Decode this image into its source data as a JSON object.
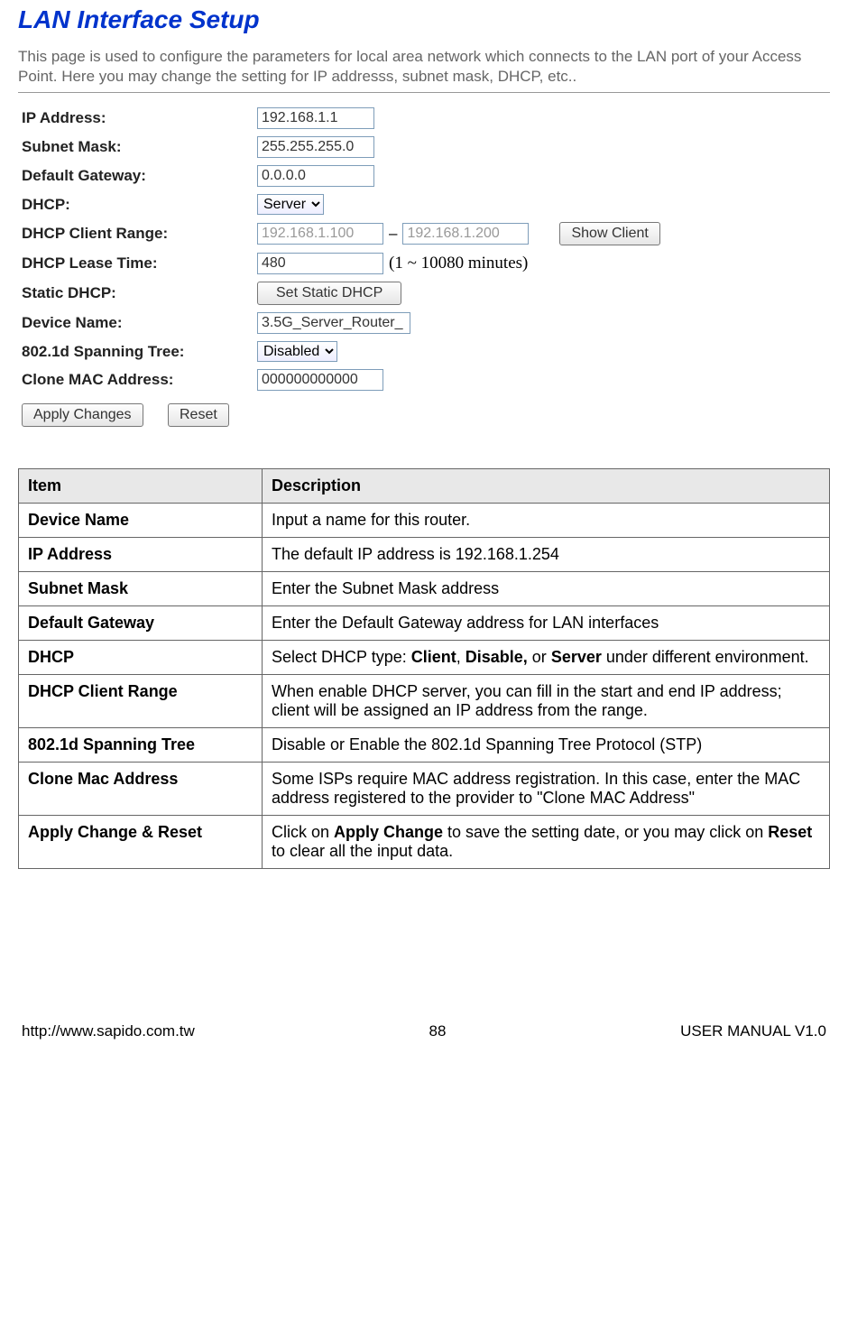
{
  "title": "LAN Interface Setup",
  "intro": "This page is used to configure the parameters for local area network which connects to the LAN port of your Access Point. Here you may change the setting for IP addresss, subnet mask, DHCP, etc..",
  "form": {
    "ip_address": {
      "label": "IP Address:",
      "value": "192.168.1.1"
    },
    "subnet_mask": {
      "label": "Subnet Mask:",
      "value": "255.255.255.0"
    },
    "default_gateway": {
      "label": "Default Gateway:",
      "value": "0.0.0.0"
    },
    "dhcp": {
      "label": "DHCP:",
      "value": "Server"
    },
    "dhcp_range": {
      "label": "DHCP Client Range:",
      "start": "192.168.1.100",
      "end": "192.168.1.200",
      "dash": "–",
      "show_client_btn": "Show Client"
    },
    "lease_time": {
      "label": "DHCP Lease Time:",
      "value": "480",
      "note": "(1 ~ 10080 minutes)"
    },
    "static_dhcp": {
      "label": "Static DHCP:",
      "btn": "Set Static DHCP"
    },
    "device_name": {
      "label": "Device Name:",
      "value": "3.5G_Server_Router_"
    },
    "spanning_tree": {
      "label": "802.1d Spanning Tree:",
      "value": "Disabled"
    },
    "clone_mac": {
      "label": "Clone MAC Address:",
      "value": "000000000000"
    },
    "apply_btn": "Apply Changes",
    "reset_btn": "Reset"
  },
  "table": {
    "headers": {
      "item": "Item",
      "desc": "Description"
    },
    "rows": [
      {
        "item": "Device Name",
        "desc": "Input a name for this router."
      },
      {
        "item": "IP Address",
        "desc": "The default IP address is 192.168.1.254"
      },
      {
        "item": "Subnet Mask",
        "desc": "Enter the Subnet Mask address"
      },
      {
        "item": "Default Gateway",
        "desc": "Enter the Default Gateway address for LAN interfaces"
      },
      {
        "item": "DHCP",
        "desc": "Select DHCP type: <b>Client</b>, <b>Disable,</b> or <b>Server</b> under different environment."
      },
      {
        "item": "DHCP Client Range",
        "desc": "When enable DHCP server, you can fill in the start and end IP address; client will be assigned an IP address from the range."
      },
      {
        "item": "802.1d Spanning Tree",
        "desc": "Disable or Enable the 802.1d Spanning Tree Protocol (STP)"
      },
      {
        "item": "Clone Mac Address",
        "desc": "Some ISPs require MAC address registration. In this case, enter the MAC address registered to the provider to \"Clone MAC Address\""
      },
      {
        "item": "Apply Change & Reset",
        "desc": "Click on <b>Apply Change</b> to save the setting date, or you may click on <b>Reset</b> to clear all the input data."
      }
    ]
  },
  "footer": {
    "left": "http://www.sapido.com.tw",
    "center": "88",
    "right": "USER MANUAL V1.0"
  }
}
